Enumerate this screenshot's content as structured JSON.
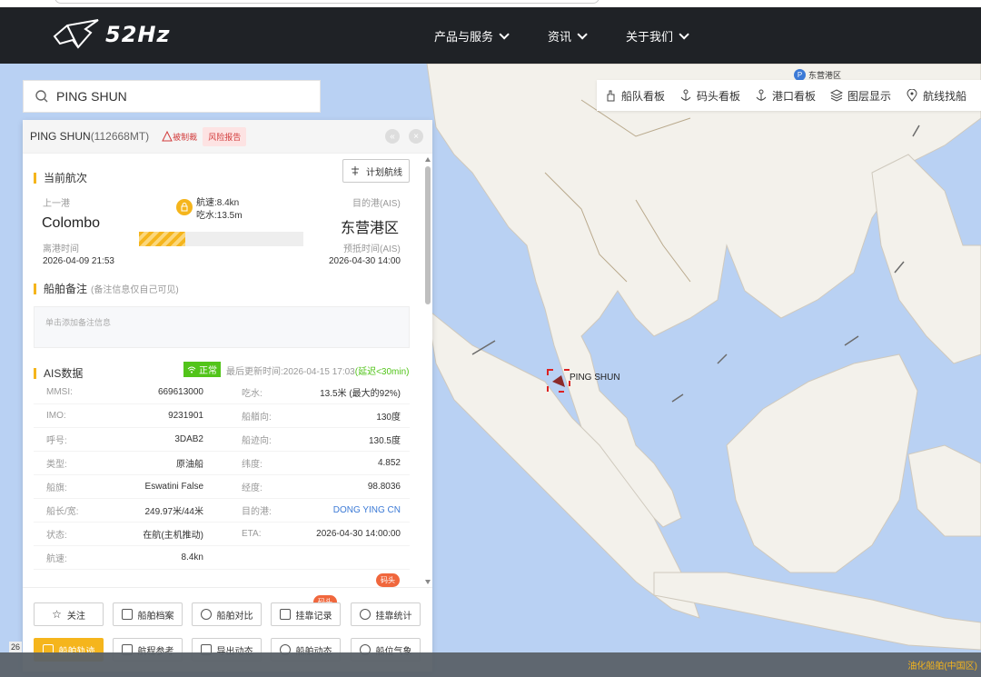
{
  "header": {
    "logo_text": "52Hz",
    "nav": [
      "产品与服务",
      "资讯",
      "关于我们"
    ]
  },
  "search": {
    "value": "PING SHUN"
  },
  "toolbar": {
    "items": [
      "船队看板",
      "码头看板",
      "港口看板",
      "图层显示",
      "航线找船"
    ]
  },
  "panel": {
    "ship_name": "PING SHUN",
    "ship_dwt": "(112668MT)",
    "sanction": "被制裁",
    "risk": "风险报告",
    "voyage": {
      "title": "当前航次",
      "plan_btn": "计划航线",
      "prev_label": "上一港",
      "prev_port": "Colombo",
      "dep_label": "离港时间",
      "dep_time": "2026-04-09 21:53",
      "speed": "航速:8.4kn",
      "draught": "吃水:13.5m",
      "progress": 0.28,
      "dest_label": "目的港(AIS)",
      "dest_port": "东营港区",
      "eta_label": "预抵时间(AIS)",
      "eta_time": "2026-04-30 14:00"
    },
    "remark": {
      "title": "船舶备注",
      "note": "(备注信息仅自己可见)",
      "placeholder": "单击添加备注信息"
    },
    "ais": {
      "title": "AIS数据",
      "status": "正常",
      "updated": "最后更新时间:2026-04-15 17:03",
      "delay": "(延迟<30min)",
      "rows": [
        {
          "k1": "MMSI:",
          "v1": "669613000",
          "k2": "吃水:",
          "v2": "13.5米 (最大的92%)"
        },
        {
          "k1": "IMO:",
          "v1": "9231901",
          "k2": "船艏向:",
          "v2": "130度"
        },
        {
          "k1": "呼号:",
          "v1": "3DAB2",
          "k2": "船迹向:",
          "v2": "130.5度"
        },
        {
          "k1": "类型:",
          "v1": "原油船",
          "k2": "纬度:",
          "v2": "4.852"
        },
        {
          "k1": "船旗:",
          "v1": "Eswatini False",
          "k2": "经度:",
          "v2": "98.8036"
        },
        {
          "k1": "船长/宽:",
          "v1": "249.97米/44米",
          "k2": "目的港:",
          "v2": "DONG YING CN"
        },
        {
          "k1": "状态:",
          "v1": "在航(主机推动)",
          "k2": "ETA:",
          "v2": "2026-04-30 14:00:00"
        },
        {
          "k1": "航速:",
          "v1": "8.4kn",
          "k2": "",
          "v2": ""
        }
      ]
    },
    "dock_badge": "码头",
    "footer": {
      "hot_badge": "码头",
      "row1": [
        "关注",
        "船舶档案",
        "船舶对比",
        "挂靠记录",
        "挂靠统计"
      ],
      "row2": [
        "船舶轨迹",
        "航程参考",
        "导出动态",
        "船舶动态",
        "船位气象"
      ]
    }
  },
  "map": {
    "ship_label": "PING SHUN",
    "port_label": "东营港区",
    "bottom_right": "油化船舶(中国区)",
    "bottom_left": "26"
  }
}
